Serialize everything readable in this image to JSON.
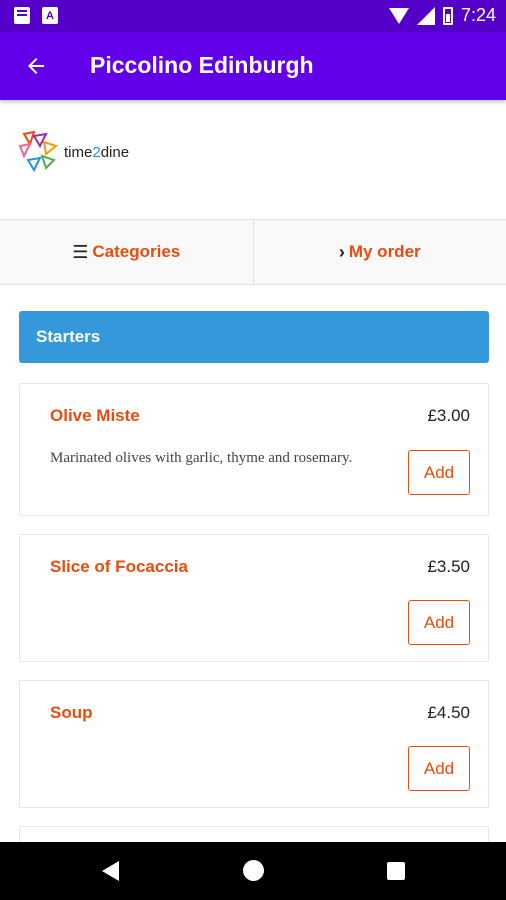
{
  "status_bar": {
    "time": "7:24"
  },
  "app_bar": {
    "title": "Piccolino Edinburgh"
  },
  "logo": {
    "text_prefix": "time",
    "text_number": "2",
    "text_suffix": "dine"
  },
  "tabs": [
    {
      "label": "Categories",
      "icon": "menu-icon"
    },
    {
      "label": "My order",
      "icon": "chevron-right-icon"
    }
  ],
  "section": {
    "title": "Starters"
  },
  "items": [
    {
      "name": "Olive Miste",
      "price": "£3.00",
      "description": "Marinated olives with garlic, thyme and rosemary.",
      "add_label": "Add"
    },
    {
      "name": "Slice of Focaccia",
      "price": "£3.50",
      "description": "",
      "add_label": "Add"
    },
    {
      "name": "Soup",
      "price": "£4.50",
      "description": "",
      "add_label": "Add"
    }
  ],
  "colors": {
    "primary": "#6200ea",
    "status": "#5400c9",
    "accent": "#e84c0e",
    "section": "#3498db"
  }
}
